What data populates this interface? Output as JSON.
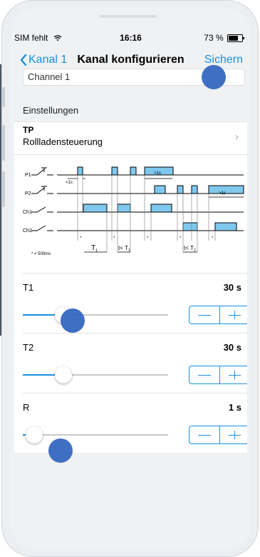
{
  "status": {
    "carrier": "SIM fehlt",
    "time": "16:16",
    "battery": "73 %"
  },
  "nav": {
    "back": "Kanal 1",
    "title": "Kanal konfigurieren",
    "save": "Sichern"
  },
  "channel_name": "Channel 1",
  "settings": {
    "header": "Einstellungen",
    "type_code": "TP",
    "type_name": "Rollladensteuerung"
  },
  "diagram": {
    "labels": [
      "P1",
      "P2",
      "Ch1",
      "Ch2"
    ],
    "note": "* = 500ms",
    "t1": "T",
    "t1_sub": "1",
    "lt_t1": "t< T",
    "lt_t1_sub": "1",
    "lt_t2": "t< T",
    "lt_t2_sub": "2",
    "lt1s": "<1s",
    "gt1s": ">1s",
    "star": "*"
  },
  "sliders": [
    {
      "label": "T1",
      "value": "30 s",
      "fraction": 0.28
    },
    {
      "label": "T2",
      "value": "30 s",
      "fraction": 0.28
    },
    {
      "label": "R",
      "value": "1 s",
      "fraction": 0.08
    }
  ],
  "colors": {
    "accent": "#1a8fe0",
    "pulse": "#7fc8ee",
    "tap_marker": "#3567bf"
  }
}
